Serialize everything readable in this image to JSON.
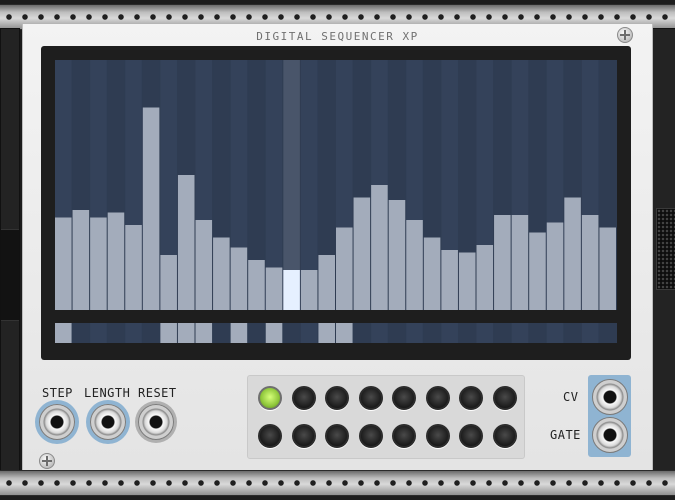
{
  "module": {
    "title": "DIGITAL SEQUENCER XP"
  },
  "sequencer": {
    "steps": 32,
    "current_step": 13,
    "cv_values": [
      0.37,
      0.4,
      0.37,
      0.39,
      0.34,
      0.81,
      0.22,
      0.54,
      0.36,
      0.29,
      0.25,
      0.2,
      0.17,
      0.16,
      0.16,
      0.22,
      0.33,
      0.45,
      0.5,
      0.44,
      0.36,
      0.29,
      0.24,
      0.23,
      0.26,
      0.38,
      0.38,
      0.31,
      0.35,
      0.45,
      0.38,
      0.33
    ],
    "gates": [
      1,
      0,
      0,
      0,
      0,
      0,
      1,
      1,
      1,
      0,
      1,
      0,
      1,
      0,
      0,
      1,
      1,
      0,
      0,
      0,
      0,
      0,
      0,
      0,
      0,
      0,
      0,
      0,
      0,
      0,
      0,
      0
    ],
    "colors": {
      "screen_bg": "#2f3c52",
      "column_alt": "#34425a",
      "bar": "#a3acbb",
      "bar_current": "#e6f0ff",
      "current_column": "#49556a",
      "accent": "#8fb4d2",
      "led_on": "#8ec63a"
    }
  },
  "inputs": {
    "step_label": "STEP",
    "length_label": "LENGTH",
    "reset_label": "RESET"
  },
  "outputs": {
    "cv_label": "CV",
    "gate_label": "GATE"
  },
  "step_buttons": {
    "count": 16,
    "active_index": 0
  }
}
